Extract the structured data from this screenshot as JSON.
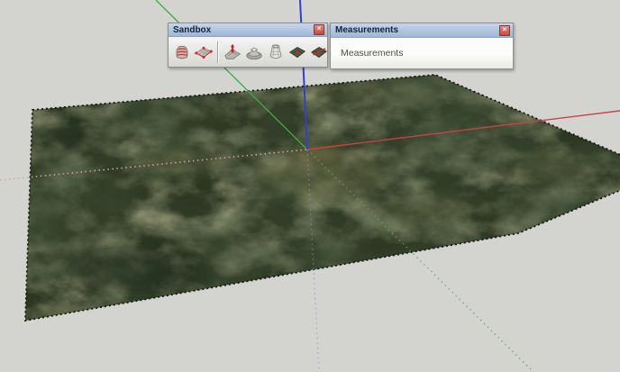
{
  "app": {
    "name": "SketchUp viewport",
    "background_color": "#d3d3d0"
  },
  "toolbars": {
    "sandbox": {
      "title": "Sandbox",
      "close_glyph": "×",
      "tools": [
        {
          "icon": "from-contours-icon"
        },
        {
          "icon": "from-scratch-icon"
        },
        {
          "icon": "smoove-icon"
        },
        {
          "icon": "stamp-icon"
        },
        {
          "icon": "drape-icon"
        },
        {
          "icon": "add-detail-icon"
        },
        {
          "icon": "flip-edge-icon"
        }
      ]
    },
    "measurements": {
      "title": "Measurements",
      "close_glyph": "×",
      "field_label": "Measurements"
    }
  },
  "viewport": {
    "axes": {
      "red": {
        "color": "#c84444",
        "dotted_color": "#d8a2a2"
      },
      "green": {
        "color": "#3cae3c",
        "dotted_color": "#4cb44c"
      },
      "blue": {
        "color": "#3142c8",
        "dotted_color": "#8a93cf"
      }
    },
    "terrain": {
      "base_color": "#2c3622",
      "edge_color": "#15180f"
    }
  }
}
